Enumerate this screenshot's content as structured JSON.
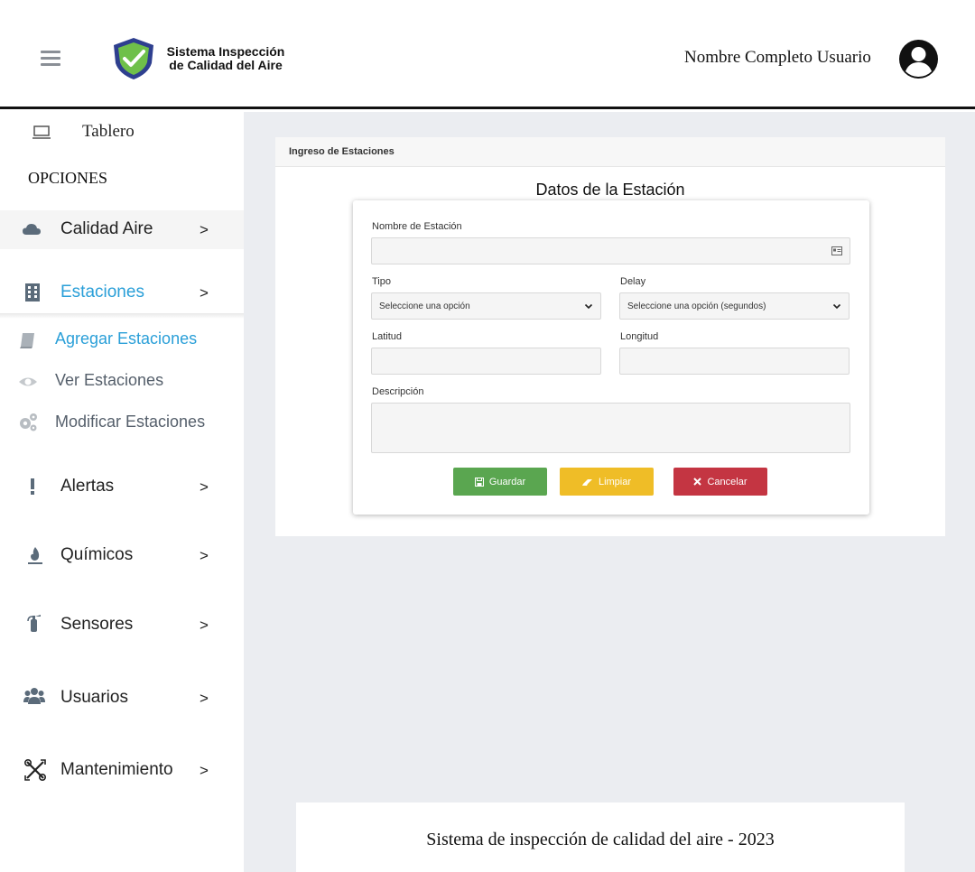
{
  "header": {
    "app_title_line1": "Sistema Inspección",
    "app_title_line2": "de Calidad del Aire",
    "user_name": "Nombre Completo Usuario",
    "icons": [
      "menu-icon",
      "shield-check-logo",
      "user-avatar-icon"
    ]
  },
  "sidebar": {
    "tablero_label": "Tablero",
    "section_label": "OPCIONES",
    "items": [
      {
        "label": "Calidad Aire",
        "arrow": ">",
        "icon": "cloud-icon"
      },
      {
        "label": "Estaciones",
        "arrow": ">",
        "icon": "building-icon",
        "active": true
      },
      {
        "label": "Alertas",
        "arrow": ">",
        "icon": "exclamation-icon"
      },
      {
        "label": "Químicos",
        "arrow": ">",
        "icon": "fire-icon"
      },
      {
        "label": "Sensores",
        "arrow": ">",
        "icon": "extinguisher-icon"
      },
      {
        "label": "Usuarios",
        "arrow": ">",
        "icon": "users-icon"
      },
      {
        "label": "Mantenimiento",
        "arrow": ">",
        "icon": "tools-icon"
      }
    ],
    "sub_items": [
      {
        "label": "Agregar Estaciones",
        "icon": "book-icon",
        "active": true
      },
      {
        "label": "Ver Estaciones",
        "icon": "eye-icon"
      },
      {
        "label": "Modificar Estaciones",
        "icon": "gears-icon"
      }
    ]
  },
  "card": {
    "header": "Ingreso de Estaciones",
    "form_title": "Datos de la Estación",
    "fields": {
      "nombre_label": "Nombre de Estación",
      "nombre_value": "",
      "tipo_label": "Tipo",
      "tipo_selected": "Seleccione una opción",
      "delay_label": "Delay",
      "delay_selected": "Seleccione una opción (segundos)",
      "latitud_label": "Latitud",
      "latitud_value": "",
      "longitud_label": "Longitud",
      "longitud_value": "",
      "descripcion_label": "Descripción",
      "descripcion_value": ""
    },
    "buttons": {
      "save": "Guardar",
      "clear": "Limpiar",
      "cancel": "Cancelar"
    }
  },
  "footer": {
    "text": "Sistema de inspección de calidad del aire - 2023"
  },
  "colors": {
    "accent_blue": "#2a9fd8",
    "save_green": "#5aa650",
    "clear_yellow": "#efbd27",
    "cancel_red": "#c43542",
    "main_bg": "#ebedf1"
  }
}
